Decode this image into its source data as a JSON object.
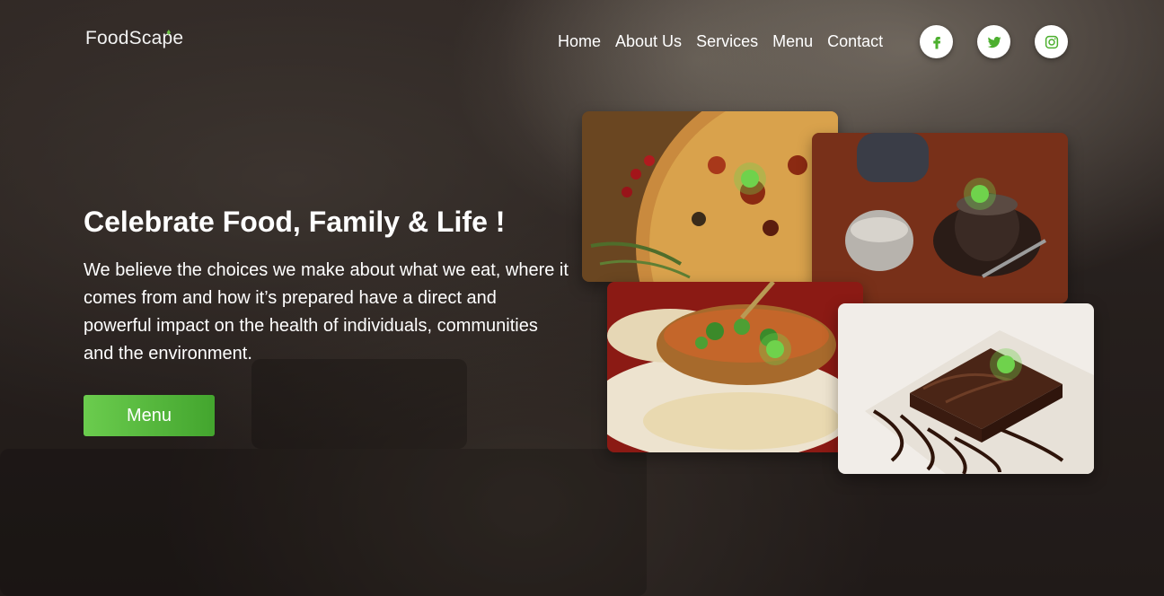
{
  "logo": {
    "text": "FoodScape"
  },
  "nav": {
    "items": [
      "Home",
      "About Us",
      "Services",
      "Menu",
      "Contact"
    ]
  },
  "socials": [
    "facebook-icon",
    "twitter-icon",
    "instagram-icon"
  ],
  "hero": {
    "title": "Celebrate Food, Family & Life !",
    "text": "We believe the choices we make about what we eat, where it comes from and how it’s prepared have a direct and powerful impact on the health of individuals, communities and the environment.",
    "button_label": "Menu"
  },
  "cards": [
    "pizza",
    "tea",
    "curry",
    "chocolate-cake"
  ],
  "colors": {
    "accent": "#5bbd3e",
    "dot": "#6fd24c"
  }
}
